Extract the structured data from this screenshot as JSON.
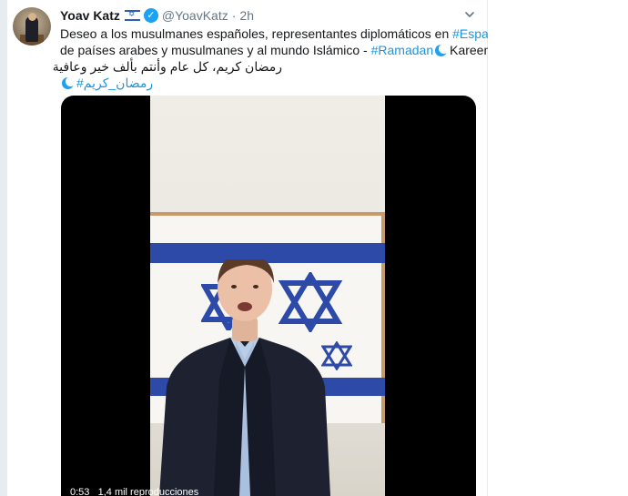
{
  "tweet": {
    "author_name": "Yoav Katz",
    "author_flag": "israel-flag-icon",
    "verified_icon": "verified-badge-icon",
    "handle": "@YoavKatz",
    "separator": "·",
    "time": "2h",
    "text": {
      "line1_prefix": "Deseo a los musulmanes españoles, representantes diplomáticos en",
      "line1_link": "#España",
      "line2_prefix": "de países arabes y musulmanes y al mundo Islámico -",
      "line2_link": "#Ramadan",
      "line2_suffix": "Kareen.",
      "line3_arabic": "رمضان كريم، كل عام وأنتم بألف خير وعافية",
      "line4_link": "#رمضان_كريم"
    },
    "video": {
      "duration": "0:53",
      "views": "1,4 mil reproducciones"
    }
  },
  "colors": {
    "link": "#1b95e0",
    "verified": "#1da1f2",
    "muted": "#657786",
    "text": "#14171a"
  }
}
